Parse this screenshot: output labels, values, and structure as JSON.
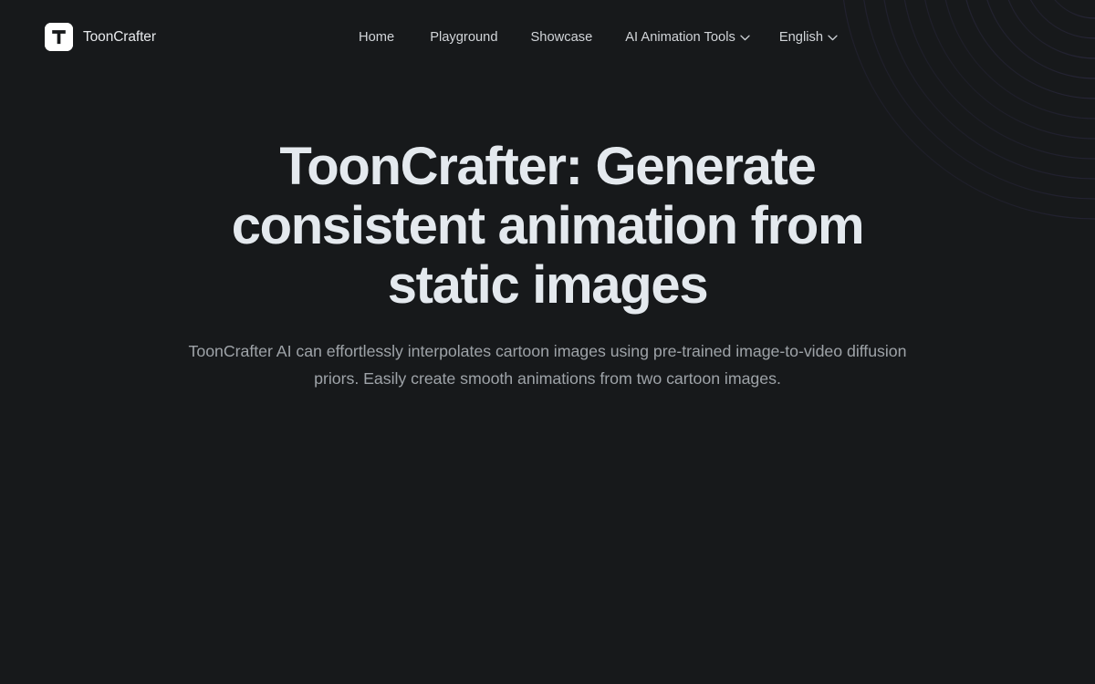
{
  "theme": {
    "background": "#17191b",
    "heading_color": "#e4e9ee",
    "subtext_color": "#9ea3a8",
    "nav_color": "#d2d5d9",
    "logo_bg": "#ffffff",
    "logo_glyph_color": "#17191b",
    "accent_curve_color": "#473f73"
  },
  "header": {
    "brand": {
      "logo_icon": "letter-t-logo-icon",
      "logo_letter": "T",
      "name": "ToonCrafter"
    },
    "nav": [
      {
        "label": "Home",
        "has_dropdown": false,
        "icon": ""
      },
      {
        "label": "Playground",
        "has_dropdown": false,
        "icon": ""
      },
      {
        "label": "Showcase",
        "has_dropdown": false,
        "icon": ""
      },
      {
        "label": "AI Animation Tools",
        "has_dropdown": true,
        "icon": "chevron-down-icon"
      },
      {
        "label": "English",
        "has_dropdown": true,
        "icon": "chevron-down-icon"
      }
    ]
  },
  "hero": {
    "title": "ToonCrafter: Generate consistent animation from static images",
    "subtitle": "ToonCrafter AI can effortlessly interpolates cartoon images using pre-trained image-to-video diffusion priors. Easily create smooth animations from two cartoon images."
  },
  "decoration": {
    "name": "concentric-arcs-pattern",
    "arc_count": 11,
    "color": "#473f73"
  }
}
